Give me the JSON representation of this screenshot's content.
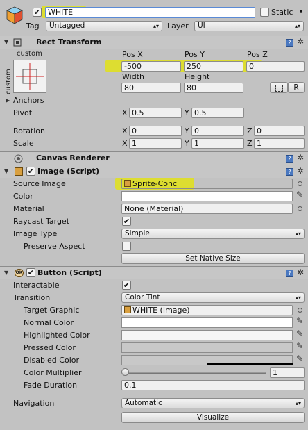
{
  "header": {
    "active": true,
    "object_name": "WHITE",
    "static_label": "Static",
    "static_checked": false,
    "tag_label": "Tag",
    "tag_value": "Untagged",
    "layer_label": "Layer",
    "layer_value": "UI"
  },
  "rect_transform": {
    "title": "Rect Transform",
    "anchor_preset_top": "custom",
    "anchor_preset_side": "custom",
    "pos_x_label": "Pos X",
    "pos_y_label": "Pos Y",
    "pos_z_label": "Pos Z",
    "pos_x": "-500",
    "pos_y": "250",
    "pos_z": "0",
    "width_label": "Width",
    "height_label": "Height",
    "width": "80",
    "height": "80",
    "raw_button": "R",
    "anchors_label": "Anchors",
    "pivot_label": "Pivot",
    "pivot_x": "0.5",
    "pivot_y": "0.5",
    "rotation_label": "Rotation",
    "rot_x": "0",
    "rot_y": "0",
    "rot_z": "0",
    "scale_label": "Scale",
    "scale_x": "1",
    "scale_y": "1",
    "scale_z": "1",
    "x": "X",
    "y": "Y",
    "z": "Z"
  },
  "canvas_renderer": {
    "title": "Canvas Renderer"
  },
  "image_script": {
    "title": "Image (Script)",
    "enabled": true,
    "source_image_label": "Source Image",
    "source_image_value": "Sprite-Conc",
    "color_label": "Color",
    "material_label": "Material",
    "material_value": "None (Material)",
    "raycast_label": "Raycast Target",
    "raycast_checked": true,
    "image_type_label": "Image Type",
    "image_type_value": "Simple",
    "preserve_aspect_label": "Preserve Aspect",
    "preserve_aspect_checked": false,
    "set_native_size": "Set Native Size"
  },
  "button_script": {
    "title": "Button (Script)",
    "enabled": true,
    "interactable_label": "Interactable",
    "interactable_checked": true,
    "transition_label": "Transition",
    "transition_value": "Color Tint",
    "target_graphic_label": "Target Graphic",
    "target_graphic_value": "WHITE (Image)",
    "normal_color_label": "Normal Color",
    "highlighted_color_label": "Highlighted Color",
    "pressed_color_label": "Pressed Color",
    "disabled_color_label": "Disabled Color",
    "color_multiplier_label": "Color Multiplier",
    "color_multiplier_value": "1",
    "fade_duration_label": "Fade Duration",
    "fade_duration_value": "0.1",
    "navigation_label": "Navigation",
    "navigation_value": "Automatic",
    "visualize": "Visualize"
  },
  "colors": {
    "highlight": "#e6e600",
    "color_white": "#ffffff",
    "pressed_color": "#c8c8c8",
    "disabled_color": "#c8c8c8"
  },
  "icons": [
    "cube-icon",
    "checkbox-icon",
    "book-icon",
    "gear-icon",
    "dropdown-arrow-icon",
    "object-picker-icon",
    "eyedropper-icon",
    "foldout-arrow-icon",
    "anchor-preset-icon",
    "blueprint-icon",
    "sprite-icon"
  ]
}
